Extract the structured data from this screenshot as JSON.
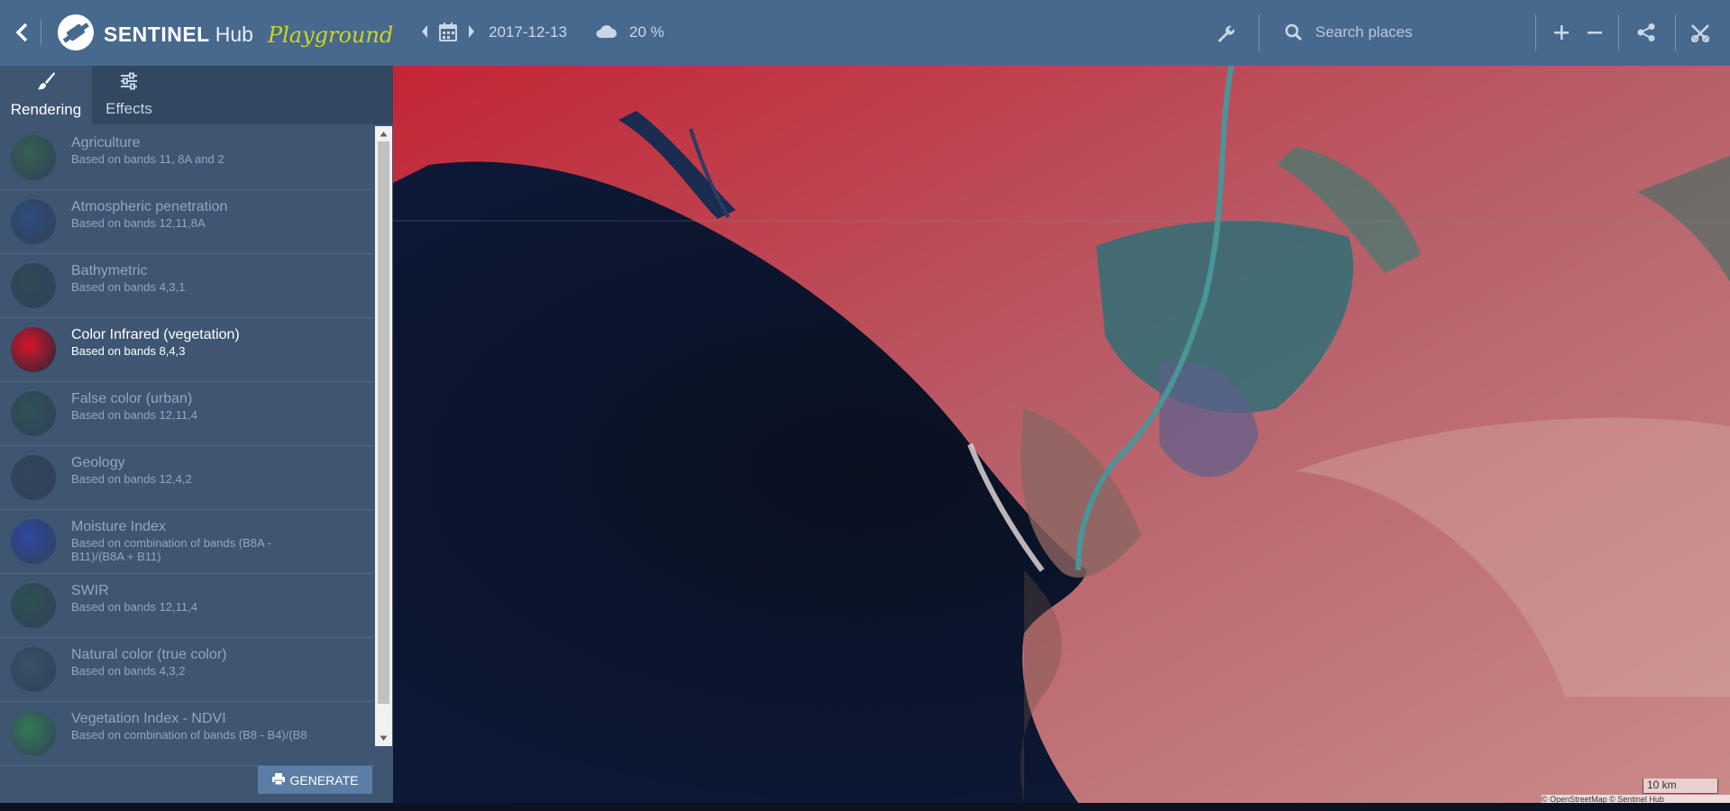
{
  "header": {
    "brand_word": "SENTINEL",
    "brand_sub": "Hub",
    "brand_tag": "Playground",
    "date": "2017-12-13",
    "cloud_coverage": "20 %",
    "search_placeholder": "Search places",
    "icons": [
      "back-icon",
      "satellite-logo-icon",
      "prev-date-icon",
      "calendar-icon",
      "next-date-icon",
      "cloud-icon",
      "wrench-icon",
      "search-icon",
      "zoom-in-icon",
      "zoom-out-icon",
      "share-icon",
      "compare-tool-icon"
    ]
  },
  "tabs": [
    {
      "label": "Rendering",
      "icon": "brush-icon",
      "active": true
    },
    {
      "label": "Effects",
      "icon": "sliders-icon",
      "active": false
    }
  ],
  "layers": [
    {
      "title": "Agriculture",
      "desc": "Based on bands 11, 8A and 2",
      "color": "#2e6b2a"
    },
    {
      "title": "Atmospheric penetration",
      "desc": "Based on bands 12,11,8A",
      "color": "#1d3f8a"
    },
    {
      "title": "Bathymetric",
      "desc": "Based on bands 4,3,1",
      "color": "#223a36"
    },
    {
      "title": "Color Infrared (vegetation)",
      "desc": "Based on bands 8,4,3",
      "color": "#d9152a",
      "active": true
    },
    {
      "title": "False color (urban)",
      "desc": "Based on bands 12,11,4",
      "color": "#1f4a33"
    },
    {
      "title": "Geology",
      "desc": "Based on bands 12,4,2",
      "color": "#243140"
    },
    {
      "title": "Moisture Index",
      "desc": "Based on combination of bands (B8A - B11)/(B8A + B11)",
      "color": "#1d35d8"
    },
    {
      "title": "SWIR",
      "desc": "Based on bands 12,11,4",
      "color": "#1a4a2a"
    },
    {
      "title": "Natural color (true color)",
      "desc": "Based on bands 4,3,2",
      "color": "#2f4a55"
    },
    {
      "title": "Vegetation Index - NDVI",
      "desc": "Based on combination of bands (B8 - B4)/(B8",
      "color": "#2aa233"
    }
  ],
  "generate_label": "GENERATE",
  "map": {
    "scale_label": "10 km",
    "attribution": "© OpenStreetMap © Sentinel Hub"
  }
}
